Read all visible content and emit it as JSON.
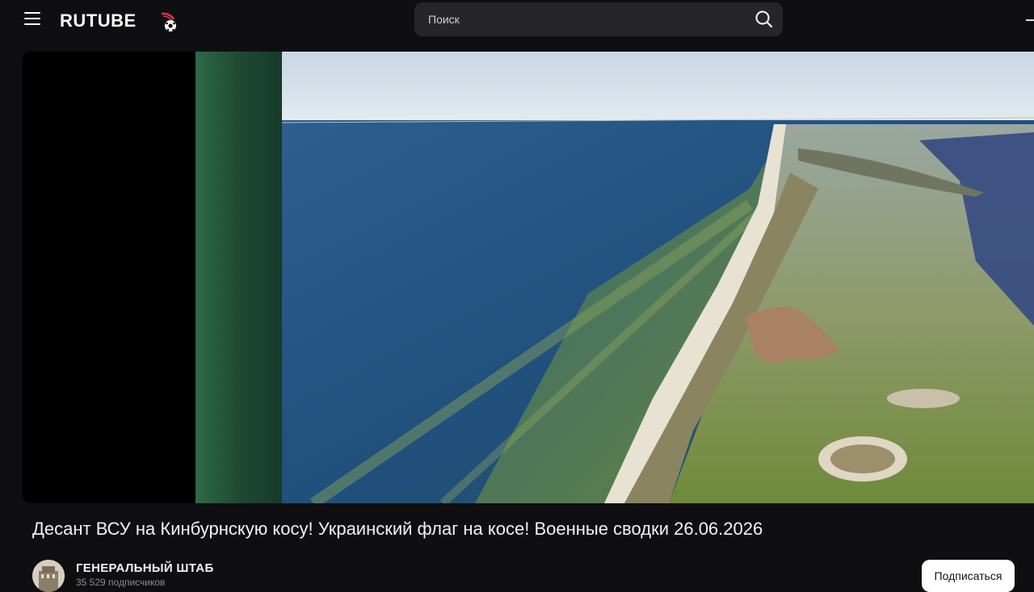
{
  "header": {
    "logo_text": "RUTUBE",
    "search_placeholder": "Поиск"
  },
  "video": {
    "title": "Десант ВСУ на Кинбурнскую косу! Украинский флаг на косе! Военные сводки 26.06.2026"
  },
  "channel": {
    "name": "ГЕНЕРАЛЬНЫЙ ШТАБ",
    "subscribers": "35 529 подписчиков",
    "subscribe_label": "Подписаться"
  },
  "colors": {
    "background": "#0f0f11",
    "search_bg": "#26262a",
    "logo_ball_red": "#e8314a",
    "subscribe_bg": "#ffffff"
  },
  "icons": {
    "menu": "hamburger-icon",
    "search": "search-icon",
    "logo_ball": "soccer-ball-icon",
    "add": "plus-icon"
  }
}
